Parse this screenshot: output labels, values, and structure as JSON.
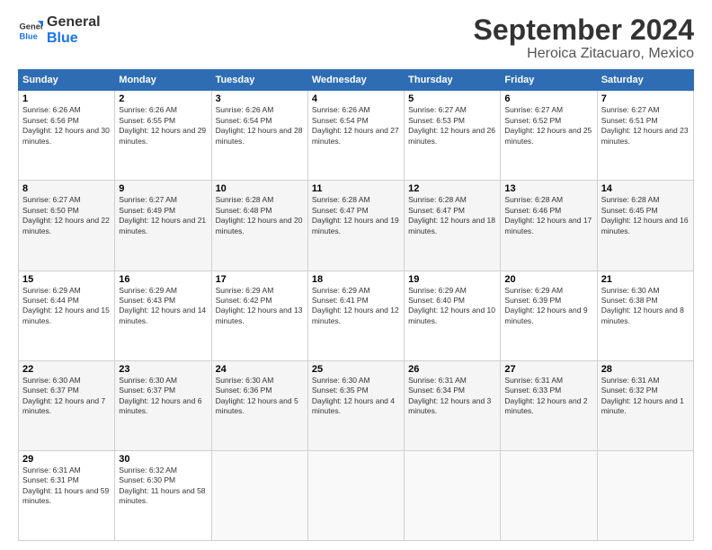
{
  "logo": {
    "line1": "General",
    "line2": "Blue"
  },
  "title": "September 2024",
  "subtitle": "Heroica Zitacuaro, Mexico",
  "days_of_week": [
    "Sunday",
    "Monday",
    "Tuesday",
    "Wednesday",
    "Thursday",
    "Friday",
    "Saturday"
  ],
  "weeks": [
    [
      {
        "day": "1",
        "sunrise": "6:26 AM",
        "sunset": "6:56 PM",
        "daylight": "12 hours and 30 minutes."
      },
      {
        "day": "2",
        "sunrise": "6:26 AM",
        "sunset": "6:55 PM",
        "daylight": "12 hours and 29 minutes."
      },
      {
        "day": "3",
        "sunrise": "6:26 AM",
        "sunset": "6:54 PM",
        "daylight": "12 hours and 28 minutes."
      },
      {
        "day": "4",
        "sunrise": "6:26 AM",
        "sunset": "6:54 PM",
        "daylight": "12 hours and 27 minutes."
      },
      {
        "day": "5",
        "sunrise": "6:27 AM",
        "sunset": "6:53 PM",
        "daylight": "12 hours and 26 minutes."
      },
      {
        "day": "6",
        "sunrise": "6:27 AM",
        "sunset": "6:52 PM",
        "daylight": "12 hours and 25 minutes."
      },
      {
        "day": "7",
        "sunrise": "6:27 AM",
        "sunset": "6:51 PM",
        "daylight": "12 hours and 23 minutes."
      }
    ],
    [
      {
        "day": "8",
        "sunrise": "6:27 AM",
        "sunset": "6:50 PM",
        "daylight": "12 hours and 22 minutes."
      },
      {
        "day": "9",
        "sunrise": "6:27 AM",
        "sunset": "6:49 PM",
        "daylight": "12 hours and 21 minutes."
      },
      {
        "day": "10",
        "sunrise": "6:28 AM",
        "sunset": "6:48 PM",
        "daylight": "12 hours and 20 minutes."
      },
      {
        "day": "11",
        "sunrise": "6:28 AM",
        "sunset": "6:47 PM",
        "daylight": "12 hours and 19 minutes."
      },
      {
        "day": "12",
        "sunrise": "6:28 AM",
        "sunset": "6:47 PM",
        "daylight": "12 hours and 18 minutes."
      },
      {
        "day": "13",
        "sunrise": "6:28 AM",
        "sunset": "6:46 PM",
        "daylight": "12 hours and 17 minutes."
      },
      {
        "day": "14",
        "sunrise": "6:28 AM",
        "sunset": "6:45 PM",
        "daylight": "12 hours and 16 minutes."
      }
    ],
    [
      {
        "day": "15",
        "sunrise": "6:29 AM",
        "sunset": "6:44 PM",
        "daylight": "12 hours and 15 minutes."
      },
      {
        "day": "16",
        "sunrise": "6:29 AM",
        "sunset": "6:43 PM",
        "daylight": "12 hours and 14 minutes."
      },
      {
        "day": "17",
        "sunrise": "6:29 AM",
        "sunset": "6:42 PM",
        "daylight": "12 hours and 13 minutes."
      },
      {
        "day": "18",
        "sunrise": "6:29 AM",
        "sunset": "6:41 PM",
        "daylight": "12 hours and 12 minutes."
      },
      {
        "day": "19",
        "sunrise": "6:29 AM",
        "sunset": "6:40 PM",
        "daylight": "12 hours and 10 minutes."
      },
      {
        "day": "20",
        "sunrise": "6:29 AM",
        "sunset": "6:39 PM",
        "daylight": "12 hours and 9 minutes."
      },
      {
        "day": "21",
        "sunrise": "6:30 AM",
        "sunset": "6:38 PM",
        "daylight": "12 hours and 8 minutes."
      }
    ],
    [
      {
        "day": "22",
        "sunrise": "6:30 AM",
        "sunset": "6:37 PM",
        "daylight": "12 hours and 7 minutes."
      },
      {
        "day": "23",
        "sunrise": "6:30 AM",
        "sunset": "6:37 PM",
        "daylight": "12 hours and 6 minutes."
      },
      {
        "day": "24",
        "sunrise": "6:30 AM",
        "sunset": "6:36 PM",
        "daylight": "12 hours and 5 minutes."
      },
      {
        "day": "25",
        "sunrise": "6:30 AM",
        "sunset": "6:35 PM",
        "daylight": "12 hours and 4 minutes."
      },
      {
        "day": "26",
        "sunrise": "6:31 AM",
        "sunset": "6:34 PM",
        "daylight": "12 hours and 3 minutes."
      },
      {
        "day": "27",
        "sunrise": "6:31 AM",
        "sunset": "6:33 PM",
        "daylight": "12 hours and 2 minutes."
      },
      {
        "day": "28",
        "sunrise": "6:31 AM",
        "sunset": "6:32 PM",
        "daylight": "12 hours and 1 minute."
      }
    ],
    [
      {
        "day": "29",
        "sunrise": "6:31 AM",
        "sunset": "6:31 PM",
        "daylight": "11 hours and 59 minutes."
      },
      {
        "day": "30",
        "sunrise": "6:32 AM",
        "sunset": "6:30 PM",
        "daylight": "11 hours and 58 minutes."
      },
      null,
      null,
      null,
      null,
      null
    ]
  ]
}
